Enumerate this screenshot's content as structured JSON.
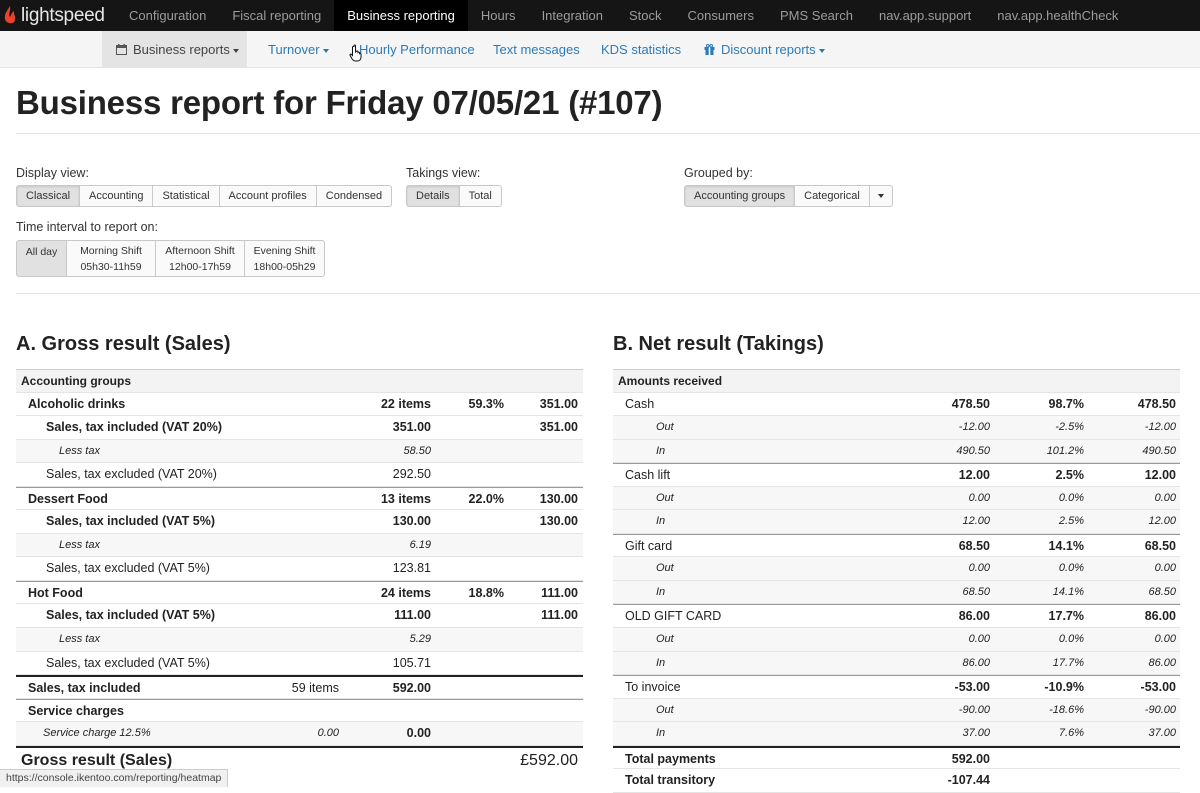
{
  "brand": {
    "name": "lightspeed",
    "accent": "#e8442c"
  },
  "topnav": [
    "Configuration",
    "Fiscal reporting",
    "Business reporting",
    "Hours",
    "Integration",
    "Stock",
    "Consumers",
    "PMS Search",
    "nav.app.support",
    "nav.app.healthCheck"
  ],
  "subnav": {
    "business_reports": "Business reports",
    "turnover": "Turnover",
    "hourly": "Hourly Performance",
    "text_messages": "Text messages",
    "kds": "KDS statistics",
    "discount": "Discount reports"
  },
  "page_title": "Business report for Friday 07/05/21 (#107)",
  "filters": {
    "display_label": "Display view:",
    "display_options": [
      "Classical",
      "Accounting",
      "Statistical",
      "Account profiles",
      "Condensed"
    ],
    "takings_label": "Takings view:",
    "takings_options": [
      "Details",
      "Total"
    ],
    "grouped_label": "Grouped by:",
    "grouped_options": [
      "Accounting groups",
      "Categorical"
    ],
    "time_label": "Time interval to report on:",
    "time_options": [
      {
        "name": "All day",
        "range": ""
      },
      {
        "name": "Morning Shift",
        "range": "05h30-11h59"
      },
      {
        "name": "Afternoon Shift",
        "range": "12h00-17h59"
      },
      {
        "name": "Evening Shift",
        "range": "18h00-05h29"
      }
    ]
  },
  "gross": {
    "title": "A. Gross result (Sales)",
    "header": "Accounting groups",
    "rows": [
      {
        "label": "Alcoholic drinks",
        "c1": "",
        "c2": "22 items",
        "c3": "59.3%",
        "c4": "351.00",
        "style": "group"
      },
      {
        "label": "Sales, tax included (VAT 20%)",
        "c1": "",
        "c2": "351.00",
        "c3": "",
        "c4": "351.00",
        "style": "sub"
      },
      {
        "label": "Less tax",
        "c1": "",
        "c2": "58.50",
        "c3": "",
        "c4": "",
        "style": "tax"
      },
      {
        "label": "Sales, tax excluded (VAT 20%)",
        "c1": "",
        "c2": "292.50",
        "c3": "",
        "c4": "",
        "style": "excl"
      },
      {
        "label": "Dessert Food",
        "c1": "",
        "c2": "13 items",
        "c3": "22.0%",
        "c4": "130.00",
        "style": "group"
      },
      {
        "label": "Sales, tax included (VAT 5%)",
        "c1": "",
        "c2": "130.00",
        "c3": "",
        "c4": "130.00",
        "style": "sub"
      },
      {
        "label": "Less tax",
        "c1": "",
        "c2": "6.19",
        "c3": "",
        "c4": "",
        "style": "tax"
      },
      {
        "label": "Sales, tax excluded (VAT 5%)",
        "c1": "",
        "c2": "123.81",
        "c3": "",
        "c4": "",
        "style": "excl"
      },
      {
        "label": "Hot Food",
        "c1": "",
        "c2": "24 items",
        "c3": "18.8%",
        "c4": "111.00",
        "style": "group"
      },
      {
        "label": "Sales, tax included (VAT 5%)",
        "c1": "",
        "c2": "111.00",
        "c3": "",
        "c4": "111.00",
        "style": "sub"
      },
      {
        "label": "Less tax",
        "c1": "",
        "c2": "5.29",
        "c3": "",
        "c4": "",
        "style": "tax"
      },
      {
        "label": "Sales, tax excluded (VAT 5%)",
        "c1": "",
        "c2": "105.71",
        "c3": "",
        "c4": "",
        "style": "excl"
      },
      {
        "label": "Sales, tax included",
        "c1": "59 items",
        "c2": "592.00",
        "c3": "",
        "c4": "",
        "style": "total"
      },
      {
        "label": "Service charges",
        "c1": "",
        "c2": "",
        "c3": "",
        "c4": "",
        "style": "group"
      },
      {
        "label": "Service charge 12.5%",
        "c1": "0.00",
        "c2": "0.00",
        "c3": "",
        "c4": "",
        "style": "service"
      }
    ],
    "footer_label": "Gross result (Sales)",
    "footer_value": "£592.00"
  },
  "net": {
    "title": "B. Net result (Takings)",
    "header": "Amounts received",
    "rows": [
      {
        "label": "Cash",
        "c1": "478.50",
        "c2": "98.7%",
        "c3": "478.50",
        "style": "main"
      },
      {
        "label": "Out",
        "c1": "-12.00",
        "c2": "-2.5%",
        "c3": "-12.00",
        "style": "detail"
      },
      {
        "label": "In",
        "c1": "490.50",
        "c2": "101.2%",
        "c3": "490.50",
        "style": "detail"
      },
      {
        "label": "Cash lift",
        "c1": "12.00",
        "c2": "2.5%",
        "c3": "12.00",
        "style": "main"
      },
      {
        "label": "Out",
        "c1": "0.00",
        "c2": "0.0%",
        "c3": "0.00",
        "style": "detail"
      },
      {
        "label": "In",
        "c1": "12.00",
        "c2": "2.5%",
        "c3": "12.00",
        "style": "detail"
      },
      {
        "label": "Gift card",
        "c1": "68.50",
        "c2": "14.1%",
        "c3": "68.50",
        "style": "main"
      },
      {
        "label": "Out",
        "c1": "0.00",
        "c2": "0.0%",
        "c3": "0.00",
        "style": "detail"
      },
      {
        "label": "In",
        "c1": "68.50",
        "c2": "14.1%",
        "c3": "68.50",
        "style": "detail"
      },
      {
        "label": "OLD GIFT CARD",
        "c1": "86.00",
        "c2": "17.7%",
        "c3": "86.00",
        "style": "main"
      },
      {
        "label": "Out",
        "c1": "0.00",
        "c2": "0.0%",
        "c3": "0.00",
        "style": "detail"
      },
      {
        "label": "In",
        "c1": "86.00",
        "c2": "17.7%",
        "c3": "86.00",
        "style": "detail"
      },
      {
        "label": "To invoice",
        "c1": "-53.00",
        "c2": "-10.9%",
        "c3": "-53.00",
        "style": "main"
      },
      {
        "label": "Out",
        "c1": "-90.00",
        "c2": "-18.6%",
        "c3": "-90.00",
        "style": "detail"
      },
      {
        "label": "In",
        "c1": "37.00",
        "c2": "7.6%",
        "c3": "37.00",
        "style": "detail"
      },
      {
        "label": "Total payments",
        "c1": "592.00",
        "c2": "",
        "c3": "",
        "style": "total"
      },
      {
        "label": "Total transitory",
        "c1": "-107.44",
        "c2": "",
        "c3": "",
        "style": "total"
      }
    ]
  },
  "status_url": "https://console.ikentoo.com/reporting/heatmap"
}
